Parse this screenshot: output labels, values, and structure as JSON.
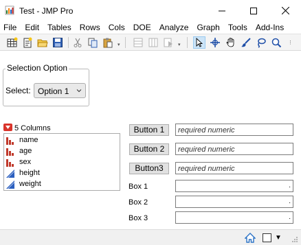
{
  "window": {
    "title": "Test - JMP Pro"
  },
  "menu": [
    "File",
    "Edit",
    "Tables",
    "Rows",
    "Cols",
    "DOE",
    "Analyze",
    "Graph",
    "Tools",
    "Add-Ins"
  ],
  "toolbar_icons": [
    "new-data-table-icon",
    "new-script-icon",
    "open-icon",
    "save-icon",
    "cut-icon",
    "copy-icon",
    "paste-icon",
    "new-row-icon",
    "new-column-icon",
    "run-script-icon",
    "arrow-tool-icon",
    "crosshair-tool-icon",
    "grabber-tool-icon",
    "brush-tool-icon",
    "lasso-tool-icon",
    "magnifier-tool-icon"
  ],
  "selection": {
    "legend": "Selection Option",
    "label": "Select:",
    "value": "Option 1"
  },
  "columns": {
    "header": "5 Columns",
    "items": [
      {
        "name": "name",
        "type": "nominal"
      },
      {
        "name": "age",
        "type": "nominal"
      },
      {
        "name": "sex",
        "type": "nominal"
      },
      {
        "name": "height",
        "type": "continuous"
      },
      {
        "name": "weight",
        "type": "continuous"
      }
    ]
  },
  "buttons": [
    "Button 1",
    "Button 2",
    "Button3"
  ],
  "fields": [
    "required numeric",
    "required numeric",
    "required numeric"
  ],
  "boxes": [
    "Box 1",
    "Box 2",
    "Box 3"
  ],
  "colors": {
    "nominal": "#c0392b",
    "continuous": "#2b5fbf",
    "disclosure": "#d9342b"
  }
}
